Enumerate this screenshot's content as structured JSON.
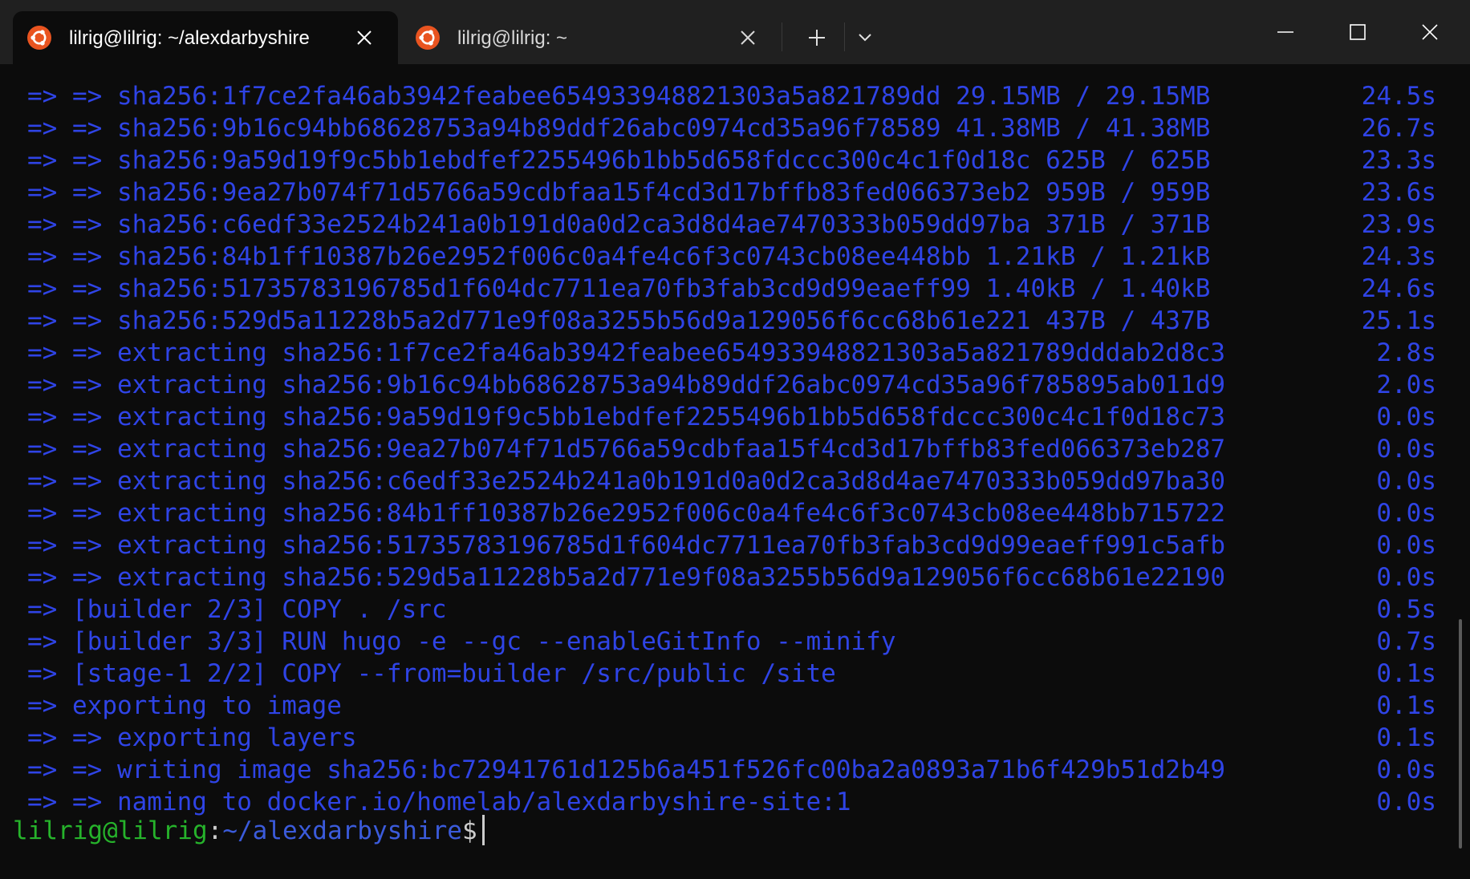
{
  "tabs": [
    {
      "title": "lilrig@lilrig: ~/alexdarbyshire",
      "icon": "ubuntu-icon",
      "active": true
    },
    {
      "title": "lilrig@lilrig: ~",
      "icon": "ubuntu-icon",
      "active": false
    }
  ],
  "colors": {
    "output": "#2f44e6",
    "prompt_user": "#26b32b",
    "prompt_path": "#3b5bdb",
    "ubuntu": "#e95420",
    "titlebar": "#202020",
    "terminal_bg": "#0c0c0c"
  },
  "terminal": {
    "lines": [
      {
        "text": "=> => sha256:1f7ce2fa46ab3942feabee654933948821303a5a821789dd 29.15MB / 29.15MB",
        "time": "24.5s"
      },
      {
        "text": "=> => sha256:9b16c94bb68628753a94b89ddf26abc0974cd35a96f78589 41.38MB / 41.38MB",
        "time": "26.7s"
      },
      {
        "text": "=> => sha256:9a59d19f9c5bb1ebdfef2255496b1bb5d658fdccc300c4c1f0d18c 625B / 625B",
        "time": "23.3s"
      },
      {
        "text": "=> => sha256:9ea27b074f71d5766a59cdbfaa15f4cd3d17bffb83fed066373eb2 959B / 959B",
        "time": "23.6s"
      },
      {
        "text": "=> => sha256:c6edf33e2524b241a0b191d0a0d2ca3d8d4ae7470333b059dd97ba 371B / 371B",
        "time": "23.9s"
      },
      {
        "text": "=> => sha256:84b1ff10387b26e2952f006c0a4fe4c6f3c0743cb08ee448bb 1.21kB / 1.21kB",
        "time": "24.3s"
      },
      {
        "text": "=> => sha256:51735783196785d1f604dc7711ea70fb3fab3cd9d99eaeff99 1.40kB / 1.40kB",
        "time": "24.6s"
      },
      {
        "text": "=> => sha256:529d5a11228b5a2d771e9f08a3255b56d9a129056f6cc68b61e221 437B / 437B",
        "time": "25.1s"
      },
      {
        "text": "=> => extracting sha256:1f7ce2fa46ab3942feabee654933948821303a5a821789dddab2d8c3",
        "time": "2.8s"
      },
      {
        "text": "=> => extracting sha256:9b16c94bb68628753a94b89ddf26abc0974cd35a96f785895ab011d9",
        "time": "2.0s"
      },
      {
        "text": "=> => extracting sha256:9a59d19f9c5bb1ebdfef2255496b1bb5d658fdccc300c4c1f0d18c73",
        "time": "0.0s"
      },
      {
        "text": "=> => extracting sha256:9ea27b074f71d5766a59cdbfaa15f4cd3d17bffb83fed066373eb287",
        "time": "0.0s"
      },
      {
        "text": "=> => extracting sha256:c6edf33e2524b241a0b191d0a0d2ca3d8d4ae7470333b059dd97ba30",
        "time": "0.0s"
      },
      {
        "text": "=> => extracting sha256:84b1ff10387b26e2952f006c0a4fe4c6f3c0743cb08ee448bb715722",
        "time": "0.0s"
      },
      {
        "text": "=> => extracting sha256:51735783196785d1f604dc7711ea70fb3fab3cd9d99eaeff991c5afb",
        "time": "0.0s"
      },
      {
        "text": "=> => extracting sha256:529d5a11228b5a2d771e9f08a3255b56d9a129056f6cc68b61e22190",
        "time": "0.0s"
      },
      {
        "text": "=> [builder 2/3] COPY . /src",
        "time": "0.5s"
      },
      {
        "text": "=> [builder 3/3] RUN hugo -e --gc --enableGitInfo --minify",
        "time": "0.7s"
      },
      {
        "text": "=> [stage-1 2/2] COPY --from=builder /src/public /site",
        "time": "0.1s"
      },
      {
        "text": "=> exporting to image",
        "time": "0.1s"
      },
      {
        "text": "=> => exporting layers",
        "time": "0.1s"
      },
      {
        "text": "=> => writing image sha256:bc72941761d125b6a451f526fc00ba2a0893a71b6f429b51d2b49",
        "time": "0.0s"
      },
      {
        "text": "=> => naming to docker.io/homelab/alexdarbyshire-site:1",
        "time": "0.0s"
      }
    ],
    "prompt": {
      "user_host": "lilrig@lilrig",
      "colon": ":",
      "path": "~/alexdarbyshire",
      "dollar": "$"
    }
  }
}
